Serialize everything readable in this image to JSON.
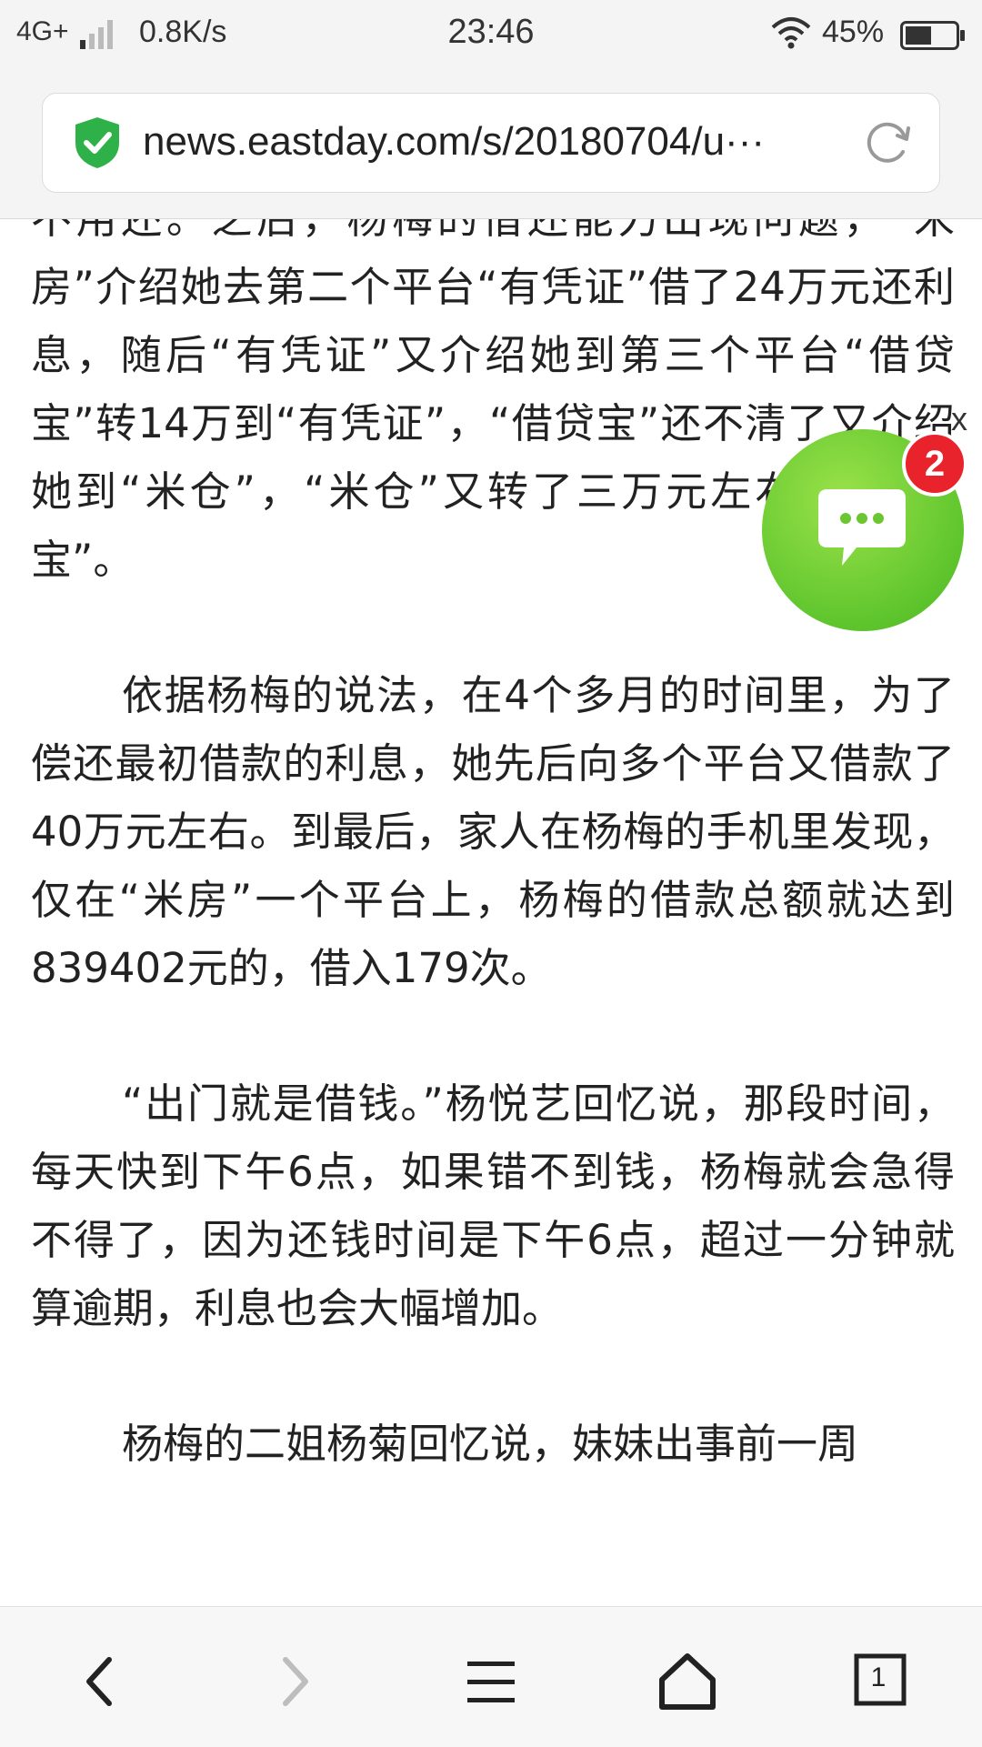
{
  "status_bar": {
    "network": "4G+",
    "speed": "0.8K/s",
    "time": "23:46",
    "battery": "45%",
    "icons": [
      "signal-icon",
      "wifi-icon",
      "battery-icon"
    ]
  },
  "address_bar": {
    "url": "news.eastday.com/s/20180704/u···",
    "icons": [
      "secure-shield-icon",
      "refresh-icon"
    ]
  },
  "article": {
    "paragraphs": [
      "不用还。之后，杨梅的借还能力出现问题，“米房”介绍她去第二个平台“有凭证”借了24万元还利息，随后“有凭证”又介绍她到第三个平台“借贷宝”转14万到“有凭证”，“借贷宝”还不清了又介绍她到“米仓”，“米仓”又转了三万元左右到“借贷宝”。",
      "依据杨梅的说法，在4个多月的时间里，为了偿还最初借款的利息，她先后向多个平台又借款了40万元左右。到最后，家人在杨梅的手机里发现，仅在“米房”一个平台上，杨梅的借款总额就达到839402元的，借入179次。",
      "“出门就是借钱。”杨悦艺回忆说，那段时间，每天快到下午6点，如果错不到钱，杨梅就会急得不得了，因为还钱时间是下午6点，超过一分钟就算逾期，利息也会大幅增加。",
      "杨梅的二姐杨菊回忆说，妹妹出事前一周"
    ]
  },
  "chat_widget": {
    "badge_count": "2",
    "close_label": "x",
    "color": "#6cc631",
    "badge_color": "#e8232c"
  },
  "bottom_nav": {
    "tab_count": "1",
    "icons": [
      "back-icon",
      "forward-icon",
      "menu-icon",
      "home-icon",
      "tabs-icon"
    ]
  }
}
